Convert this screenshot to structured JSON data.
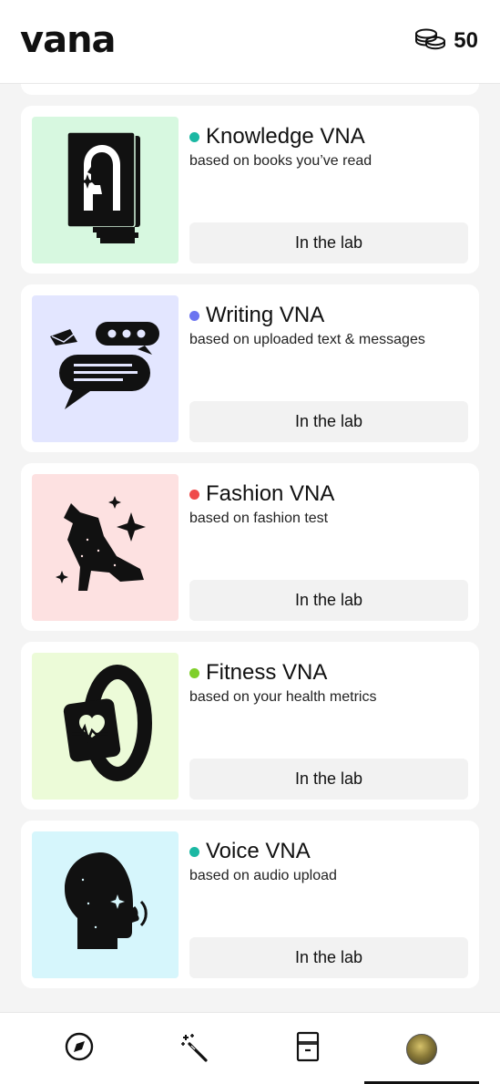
{
  "header": {
    "logo": "vana",
    "coins_value": "50",
    "coins_icon": "coins-icon"
  },
  "cards": [
    {
      "title": "Knowledge VNA",
      "subtitle": "based on books you’ve read",
      "button": "In the lab",
      "dot_color": "#1bb8a3",
      "bg_color": "#d7f8e0",
      "icon": "book-face-icon"
    },
    {
      "title": "Writing VNA",
      "subtitle": "based on uploaded text & messages",
      "button": "In the lab",
      "dot_color": "#6b73f0",
      "bg_color": "#e3e6ff",
      "icon": "chat-bubbles-icon"
    },
    {
      "title": "Fashion VNA",
      "subtitle": "based on fashion test",
      "button": "In the lab",
      "dot_color": "#ef4b4b",
      "bg_color": "#fde1e1",
      "icon": "boot-icon"
    },
    {
      "title": "Fitness VNA",
      "subtitle": "based on your health metrics",
      "button": "In the lab",
      "dot_color": "#7fcf2a",
      "bg_color": "#ecfbd8",
      "icon": "smartwatch-icon"
    },
    {
      "title": "Voice VNA",
      "subtitle": "based on audio upload",
      "button": "In the lab",
      "dot_color": "#1bb8a3",
      "bg_color": "#d6f6fc",
      "icon": "head-voice-icon"
    }
  ],
  "nav": {
    "items": [
      "compass-icon",
      "magic-wand-icon",
      "cabinet-icon",
      "profile-avatar"
    ],
    "active_index": 3
  }
}
